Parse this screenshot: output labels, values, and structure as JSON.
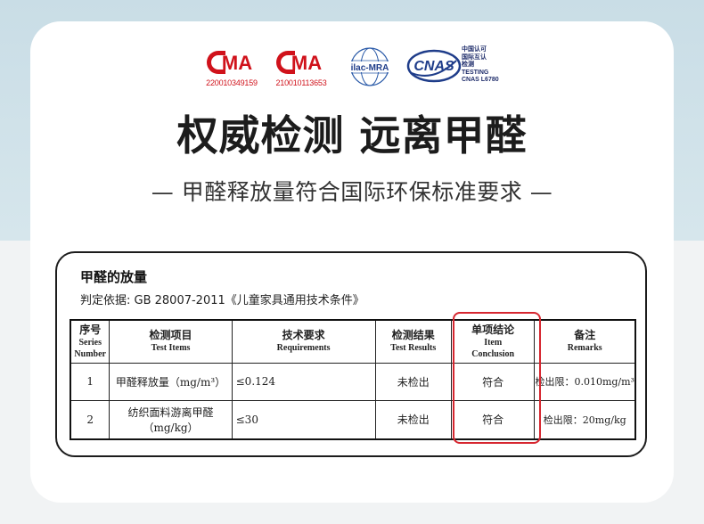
{
  "logos": {
    "cma1": {
      "text": "MA",
      "number": "220010349159"
    },
    "cma2": {
      "text": "MA",
      "number": "210010113653"
    },
    "ilac": {
      "text": "ilac-MRA"
    },
    "cnas": {
      "text": "CNAS",
      "line1": "中国认可",
      "line2": "国际互认",
      "line3": "检测",
      "line4": "TESTING",
      "line5": "CNAS L6780"
    }
  },
  "colors": {
    "brand_red": "#d0121b",
    "cnas_blue": "#1f3d8a",
    "highlight": "#d6262f"
  },
  "title": "权威检测 远离甲醛",
  "subtitle": "— 甲醛释放量符合国际环保标准要求 —",
  "panel": {
    "title": "甲醛的放量",
    "basis": "判定依据: GB 28007-2011《儿童家具通用技术条件》"
  },
  "table": {
    "headers": [
      {
        "cn": "序号",
        "en1": "Series",
        "en2": "Number"
      },
      {
        "cn": "检测项目",
        "en1": "Test Items"
      },
      {
        "cn": "技术要求",
        "en1": "Requirements"
      },
      {
        "cn": "检测结果",
        "en1": "Test Results"
      },
      {
        "cn": "单项结论",
        "en1": "Item",
        "en2": "Conclusion"
      },
      {
        "cn": "备注",
        "en1": "Remarks"
      }
    ],
    "rows": [
      {
        "no": "1",
        "item": "甲醛释放量（mg/m³）",
        "req": "≤0.124",
        "result": "未检出",
        "conclusion": "符合",
        "remark": "检出限：0.010mg/m³"
      },
      {
        "no": "2",
        "item": "纺织面料游离甲醛",
        "item2": "（mg/kg）",
        "req": "≤30",
        "result": "未检出",
        "conclusion": "符合",
        "remark": "检出限：20mg/kg"
      }
    ]
  }
}
